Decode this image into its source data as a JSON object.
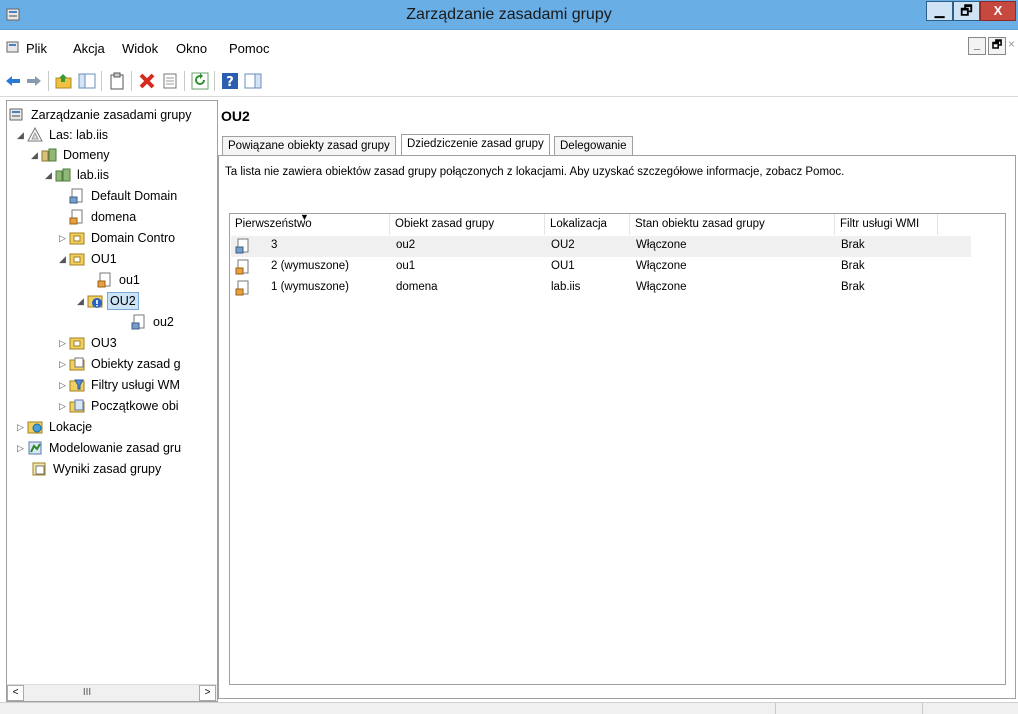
{
  "window": {
    "title": "Zarządzanie zasadami grupy",
    "controls": {
      "minimize": "▁",
      "restore": "🗗",
      "close": "X"
    }
  },
  "menubar": {
    "items": [
      "Plik",
      "Akcja",
      "Widok",
      "Okno",
      "Pomoc"
    ],
    "mdi": {
      "minimize": "_",
      "restore": "🗗",
      "close": "×"
    }
  },
  "toolbar": {
    "buttons": [
      "back-icon",
      "forward-icon",
      "up-folder-icon",
      "show-hide-tree-icon",
      "clipboard-icon",
      "delete-icon",
      "properties-icon",
      "refresh-icon",
      "help-icon",
      "action-pane-icon"
    ]
  },
  "tree": {
    "items": [
      {
        "label": "Zarządzanie zasadami grupy",
        "icon": "gpm-icon"
      },
      {
        "label": "Las: lab.iis",
        "icon": "forest-icon",
        "expander": "◢"
      },
      {
        "label": "Domeny",
        "icon": "domains-icon",
        "expander": "◢"
      },
      {
        "label": "lab.iis",
        "icon": "domain-icon",
        "expander": "◢"
      },
      {
        "label": "Default Domain",
        "icon": "gpo-link-icon"
      },
      {
        "label": "domena",
        "icon": "gpo-link-icon"
      },
      {
        "label": "Domain Contro",
        "icon": "ou-icon",
        "expander": "▷"
      },
      {
        "label": "OU1",
        "icon": "ou-icon",
        "expander": "◢"
      },
      {
        "label": "ou1",
        "icon": "gpo-link-icon"
      },
      {
        "label": "OU2",
        "icon": "ou-warning-icon",
        "expander": "◢"
      },
      {
        "label": "ou2",
        "icon": "gpo-link-icon"
      },
      {
        "label": "OU3",
        "icon": "ou-icon",
        "expander": "▷"
      },
      {
        "label": "Obiekty zasad g",
        "icon": "gpo-folder-icon",
        "expander": "▷"
      },
      {
        "label": "Filtry usługi WM",
        "icon": "wmi-filter-icon",
        "expander": "▷"
      },
      {
        "label": "Początkowe obi",
        "icon": "starter-gpo-icon",
        "expander": "▷"
      },
      {
        "label": "Lokacje",
        "icon": "sites-icon",
        "expander": "▷"
      },
      {
        "label": "Modelowanie zasad gru",
        "icon": "modeling-icon",
        "expander": "▷"
      },
      {
        "label": "Wyniki zasad grupy",
        "icon": "results-icon"
      }
    ],
    "scroll_left": "<",
    "scroll_thumb": "III",
    "scroll_right": ">"
  },
  "content": {
    "title": "OU2",
    "tabs": [
      "Powiązane obiekty zasad grupy",
      "Dziedziczenie zasad grupy",
      "Delegowanie"
    ],
    "active_tab": 1,
    "info_text": "Ta lista nie zawiera obiektów zasad grupy połączonych z lokacjami. Aby uzyskać szczegółowe informacje, zobacz Pomoc.",
    "columns": [
      "Pierwszeństwo",
      "Obiekt zasad grupy",
      "Lokalizacja",
      "Stan obiektu zasad grupy",
      "Filtr usługi WMI"
    ],
    "sort_arrow": "▼",
    "rows": [
      {
        "precedence": "3",
        "gpo": "ou2",
        "location": "OU2",
        "status": "Włączone",
        "wmi": "Brak"
      },
      {
        "precedence": "2 (wymuszone)",
        "gpo": "ou1",
        "location": "OU1",
        "status": "Włączone",
        "wmi": "Brak"
      },
      {
        "precedence": "1 (wymuszone)",
        "gpo": "domena",
        "location": "lab.iis",
        "status": "Włączone",
        "wmi": "Brak"
      }
    ]
  },
  "colors": {
    "titlebar": "#69aee5",
    "close_button": "#c7483f",
    "selection": "#cde4f7"
  }
}
